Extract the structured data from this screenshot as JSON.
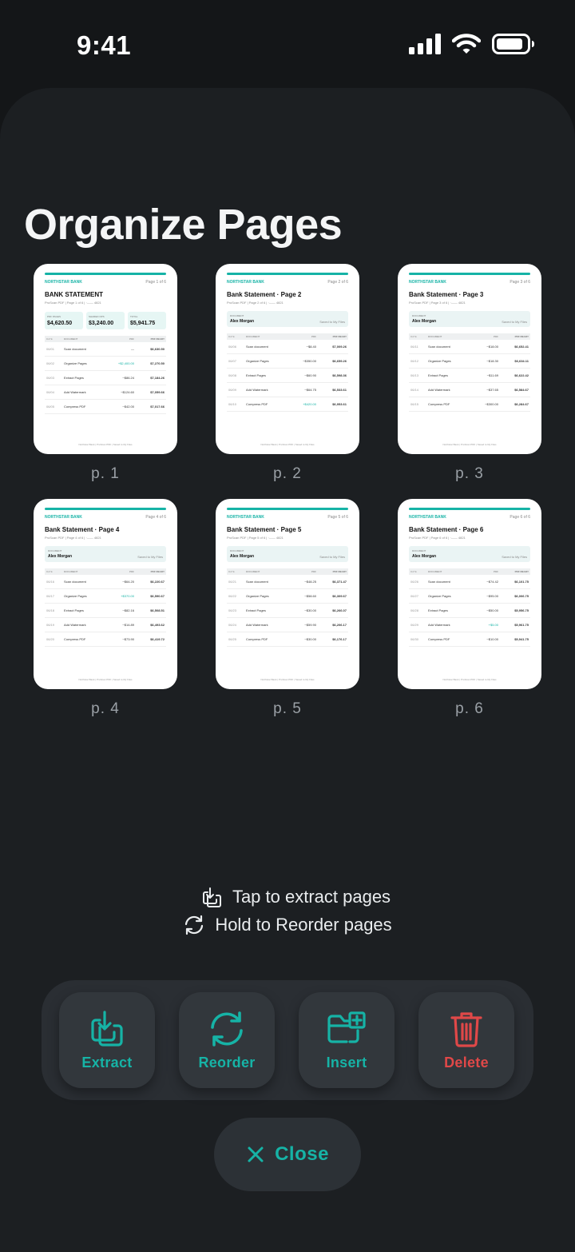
{
  "status": {
    "time": "9:41"
  },
  "title": "Organize Pages",
  "colors": {
    "accent": "#16b3a6",
    "danger": "#e04848",
    "background": "#141618"
  },
  "pages": [
    {
      "label": "p. 1",
      "doc": {
        "bank": "NORTHSTAR BANK",
        "page_num": "Page 1 of 6",
        "title": "BANK STATEMENT",
        "subtitle": "ProScan PDF  |  Page 1 of 6  |  ·—— 4821",
        "cards": [
          {
            "label": "PDF PAGES",
            "value": "$4,620.50"
          },
          {
            "label": "SHARED OPS",
            "value": "$3,240.00"
          },
          {
            "label": "TOTAL",
            "value": "$5,941.75"
          }
        ],
        "columns": [
          "DATE",
          "DOCUMENT",
          "PDF",
          "PDF READY"
        ],
        "rows": [
          [
            "06/01",
            "Scan document",
            "—",
            "$6,630.50"
          ],
          [
            "06/02",
            "Organize Pages",
            "+$2,400.00",
            "$7,270.50"
          ],
          [
            "06/03",
            "Extract Pages",
            "−$86.24",
            "$7,184.26"
          ],
          [
            "06/04",
            "Add Watermark",
            "−$124.60",
            "$7,059.66"
          ],
          [
            "06/05",
            "Compress PDF",
            "−$42.00",
            "$7,017.66"
          ]
        ],
        "footer": "Northstar Bank  |  ProScan PDF  |  Saved to My Files"
      }
    },
    {
      "label": "p. 2",
      "doc": {
        "bank": "NORTHSTAR BANK",
        "page_num": "Page 2 of 6",
        "title": "Bank Statement · Page 2",
        "subtitle": "ProScan PDF  |  Page 2 of 6  |  ·—— 4821",
        "document_label": "DOCUMENT",
        "name": "Alex Morgan",
        "saved": "Saved to My Files",
        "columns": [
          "DATE",
          "DOCUMENT",
          "PDF",
          "PDF READY"
        ],
        "rows": [
          [
            "06/06",
            "Scan document",
            "−$8.40",
            "$7,009.26"
          ],
          [
            "06/07",
            "Organize Pages",
            "−$350.00",
            "$6,659.26"
          ],
          [
            "06/08",
            "Extract Pages",
            "−$60.90",
            "$6,598.36"
          ],
          [
            "06/09",
            "Add Watermark",
            "−$64.75",
            "$6,533.61"
          ],
          [
            "06/10",
            "Compress PDF",
            "+$420.00",
            "$6,953.61"
          ]
        ],
        "footer": "Northstar Bank  |  ProScan PDF  |  Saved to My Files"
      }
    },
    {
      "label": "p. 3",
      "doc": {
        "bank": "NORTHSTAR BANK",
        "page_num": "Page 3 of 6",
        "title": "Bank Statement · Page 3",
        "subtitle": "ProScan PDF  |  Page 3 of 6  |  ·—— 4821",
        "document_label": "DOCUMENT",
        "name": "Alex Morgan",
        "saved": "Saved to My Files",
        "columns": [
          "DATE",
          "DOCUMENT",
          "PDF",
          "PDF READY"
        ],
        "rows": [
          [
            "06/11",
            "Scan document",
            "−$18.00",
            "$6,652.41"
          ],
          [
            "06/12",
            "Organize Pages",
            "−$18.30",
            "$6,634.11"
          ],
          [
            "06/13",
            "Extract Pages",
            "−$11.69",
            "$6,622.42"
          ],
          [
            "06/14",
            "Add Watermark",
            "−$37.65",
            "$6,584.67"
          ],
          [
            "06/15",
            "Compress PDF",
            "−$300.00",
            "$6,284.67"
          ]
        ],
        "footer": "Northstar Bank  |  ProScan PDF  |  Saved to My Files"
      }
    },
    {
      "label": "p. 4",
      "doc": {
        "bank": "NORTHSTAR BANK",
        "page_num": "Page 4 of 6",
        "title": "Bank Statement · Page 4",
        "subtitle": "ProScan PDF  |  Page 4 of 6  |  ·—— 4821",
        "document_label": "DOCUMENT",
        "name": "Alex Morgan",
        "saved": "Saved to My Files",
        "columns": [
          "DATE",
          "DOCUMENT",
          "PDF",
          "PDF READY"
        ],
        "rows": [
          [
            "06/16",
            "Scan document",
            "−$64.20",
            "$6,220.67"
          ],
          [
            "06/17",
            "Organize Pages",
            "+$370.00",
            "$6,590.67"
          ],
          [
            "06/18",
            "Extract Pages",
            "−$82.16",
            "$6,508.51"
          ],
          [
            "06/19",
            "Add Watermark",
            "−$14.89",
            "$6,493.62"
          ],
          [
            "06/20",
            "Compress PDF",
            "−$73.90",
            "$6,419.72"
          ]
        ],
        "footer": "Northstar Bank  |  ProScan PDF  |  Saved to My Files"
      }
    },
    {
      "label": "p. 5",
      "doc": {
        "bank": "NORTHSTAR BANK",
        "page_num": "Page 5 of 6",
        "title": "Bank Statement · Page 5",
        "subtitle": "ProScan PDF  |  Page 5 of 6  |  ·—— 4821",
        "document_label": "DOCUMENT",
        "name": "Alex Morgan",
        "saved": "Saved to My Files",
        "columns": [
          "DATE",
          "DOCUMENT",
          "PDF",
          "PDF READY"
        ],
        "rows": [
          [
            "06/21",
            "Scan document",
            "−$48.25",
            "$6,371.47"
          ],
          [
            "06/22",
            "Organize Pages",
            "−$58.60",
            "$6,309.67"
          ],
          [
            "06/23",
            "Extract Pages",
            "−$30.00",
            "$6,266.07"
          ],
          [
            "06/24",
            "Add Watermark",
            "−$59.90",
            "$6,206.17"
          ],
          [
            "06/25",
            "Compress PDF",
            "−$30.00",
            "$6,176.17"
          ]
        ],
        "footer": "Northstar Bank  |  ProScan PDF  |  Saved to My Files"
      }
    },
    {
      "label": "p. 6",
      "doc": {
        "bank": "NORTHSTAR BANK",
        "page_num": "Page 6 of 6",
        "title": "Bank Statement · Page 6",
        "subtitle": "ProScan PDF  |  Page 6 of 6  |  ·—— 4821",
        "document_label": "DOCUMENT",
        "name": "Alex Morgan",
        "saved": "Saved to My Files",
        "columns": [
          "DATE",
          "DOCUMENT",
          "PDF",
          "PDF READY"
        ],
        "rows": [
          [
            "06/26",
            "Scan document",
            "−$74.42",
            "$6,101.75"
          ],
          [
            "06/27",
            "Organize Pages",
            "−$95.00",
            "$6,006.75"
          ],
          [
            "06/28",
            "Extract Pages",
            "−$50.00",
            "$5,956.75"
          ],
          [
            "06/29",
            "Add Watermark",
            "+$5.00",
            "$5,961.75"
          ],
          [
            "06/30",
            "Compress PDF",
            "−$10.00",
            "$5,941.75"
          ]
        ],
        "footer": "Northstar Bank  |  ProScan PDF  |  Saved to My Files"
      }
    }
  ],
  "hints": {
    "extract": "Tap to extract pages",
    "reorder": "Hold to Reorder pages"
  },
  "toolbar": {
    "extract": "Extract",
    "reorder": "Reorder",
    "insert": "Insert",
    "delete": "Delete"
  },
  "close_label": "Close"
}
